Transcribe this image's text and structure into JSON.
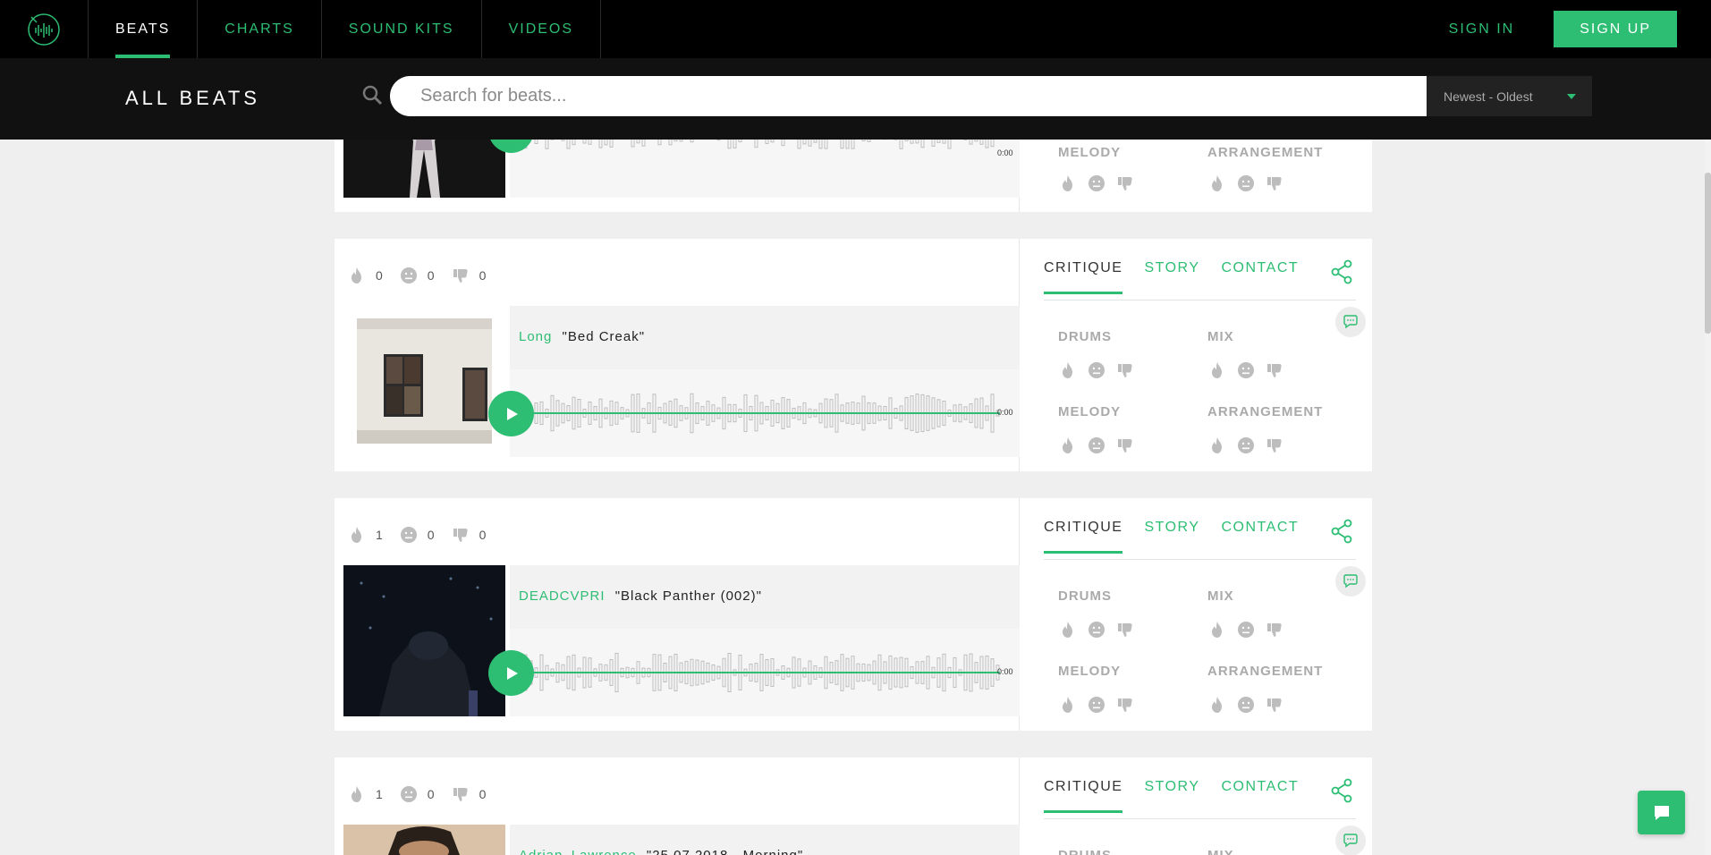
{
  "colors": {
    "accent": "#2dbd73",
    "nav_bg": "#000000",
    "subbar_bg": "#111111"
  },
  "nav": {
    "logo_icon": "waveform-logo-icon",
    "items": [
      {
        "label": "BEATS",
        "active": true
      },
      {
        "label": "CHARTS",
        "active": false
      },
      {
        "label": "SOUND KITS",
        "active": false
      },
      {
        "label": "VIDEOS",
        "active": false
      }
    ],
    "sign_in": "SIGN IN",
    "sign_up": "SIGN UP"
  },
  "subbar": {
    "title": "ALL BEATS",
    "search_placeholder": "Search for beats...",
    "sort_selected": "Newest - Oldest"
  },
  "critique": {
    "tabs": [
      "CRITIQUE",
      "STORY",
      "CONTACT"
    ],
    "categories": [
      "DRUMS",
      "MIX",
      "MELODY",
      "ARRANGEMENT"
    ]
  },
  "cards": [
    {
      "fire": "",
      "neutral": "",
      "dislike": "",
      "artist": "",
      "title": "",
      "time": "0:00",
      "partial": true
    },
    {
      "fire": "0",
      "neutral": "0",
      "dislike": "0",
      "artist": "Long",
      "title": "\"Bed Creak\"",
      "time": "0:00"
    },
    {
      "fire": "1",
      "neutral": "0",
      "dislike": "0",
      "artist": "DEADCVPRI",
      "title": "\"Black Panther (002)\"",
      "time": "0:00"
    },
    {
      "fire": "1",
      "neutral": "0",
      "dislike": "0",
      "artist": "Adrian_Lawrence",
      "title": "\"25.07.2018 - Morning\"",
      "time": ""
    }
  ]
}
